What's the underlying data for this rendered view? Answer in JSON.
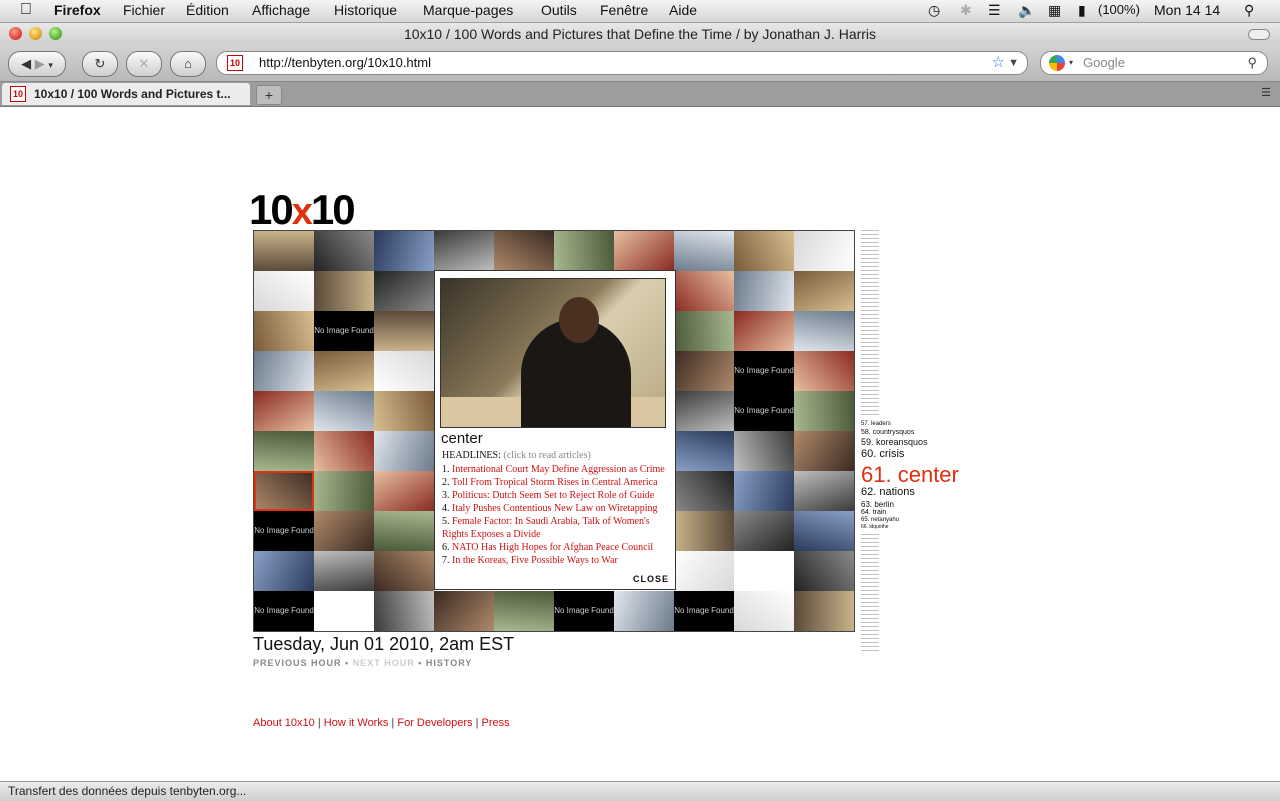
{
  "menubar": {
    "app_name": "Firefox",
    "items": [
      "Fichier",
      "Édition",
      "Affichage",
      "Historique",
      "Marque-pages",
      "Outils",
      "Fenêtre",
      "Aide"
    ],
    "battery": "(100%)",
    "clock": "Mon 14 14"
  },
  "window": {
    "title": "10x10 / 100 Words and Pictures that Define the Time / by Jonathan J. Harris"
  },
  "toolbar": {
    "url": "http://tenbyten.org/10x10.html",
    "search_placeholder": "Google",
    "favicon_text": "10"
  },
  "tabs": [
    {
      "label": "10x10 / 100 Words and Pictures t...",
      "active": true
    }
  ],
  "page": {
    "logo": {
      "left": "10",
      "x": "x",
      "right": "10"
    },
    "tiles": [
      "img",
      "img",
      "img",
      "img",
      "img",
      "img",
      "img",
      "img",
      "img",
      "img",
      "img",
      "img",
      "img",
      "img",
      "img",
      "img",
      "img",
      "img",
      "img",
      "img",
      "img",
      "No Image Found",
      "img",
      "img",
      "img",
      "img",
      "img",
      "img",
      "img",
      "img",
      "img",
      "img",
      "img",
      "img",
      "img",
      "img",
      "img",
      "img",
      "No Image Found",
      "img",
      "img",
      "img",
      "img",
      "img",
      "img",
      "img",
      "img",
      "img",
      "No Image Found",
      "img",
      "img",
      "img",
      "img",
      "img",
      "img",
      "img",
      "img",
      "img",
      "img",
      "img",
      "img",
      "img",
      "img",
      "img",
      "img",
      "img",
      "img",
      "img",
      "img",
      "img",
      "No Image Found",
      "img",
      "img",
      "img",
      "img",
      "img",
      "img",
      "img",
      "img",
      "img",
      "img",
      "img",
      "img",
      "img",
      "img",
      "img",
      "img",
      "img",
      "blank",
      "img",
      "No Image Found",
      "blank",
      "img",
      "img",
      "img",
      "No Image Found",
      "img",
      "No Image Found",
      "img",
      "img"
    ],
    "popup": {
      "word": "center",
      "headlines_label": "HEADLINES:",
      "headlines_hint": "(click to read articles)",
      "headlines": [
        "International Court May Define Aggression as Crime",
        "Toll From Tropical Storm Rises in Central America",
        "Politicus: Dutch Seem Set to Reject Role of Guide",
        "Italy Pushes Contentious New Law on Wiretapping",
        "Female Factor: In Saudi Arabia, Talk of Women's Rights Exposes a Divide",
        "NATO Has High Hopes for Afghan Peace Council",
        "In the Koreas, Five Possible Ways to War"
      ],
      "close_label": "CLOSE"
    },
    "words": [
      {
        "n": 57,
        "text": "leaders"
      },
      {
        "n": 58,
        "text": "countrysquos"
      },
      {
        "n": 59,
        "text": "koreansquos"
      },
      {
        "n": 60,
        "text": "crisis"
      },
      {
        "n": 61,
        "text": "center",
        "selected": true
      },
      {
        "n": 62,
        "text": "nations"
      },
      {
        "n": 63,
        "text": "berlin"
      },
      {
        "n": 64,
        "text": "train"
      },
      {
        "n": 65,
        "text": "netanyahu"
      },
      {
        "n": 66,
        "text": "ldquothe"
      }
    ],
    "timestamp": "Tuesday, Jun 01 2010, 2am EST",
    "hour_nav": {
      "previous": "PREVIOUS HOUR",
      "next": "NEXT HOUR",
      "history": "HISTORY"
    },
    "footer_links": [
      "About 10x10",
      "How it Works",
      "For Developers",
      "Press"
    ]
  },
  "status": "Transfert des données depuis tenbyten.org...",
  "colors": {
    "accent": "#e03010",
    "link": "#d01010"
  }
}
